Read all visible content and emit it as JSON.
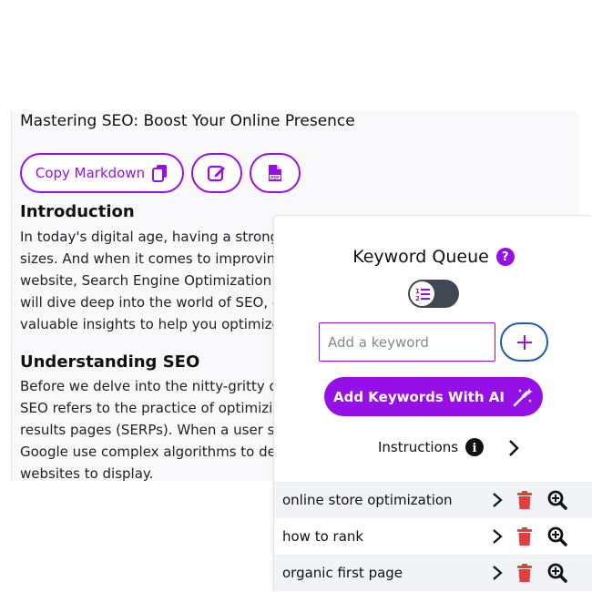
{
  "article": {
    "title": "Mastering SEO: Boost Your Online Presence",
    "copy_button_label": "Copy Markdown",
    "sections": [
      {
        "heading": "Introduction",
        "lines": [
          "In today's digital age, having a strong o",
          "sizes. And when it comes to improving",
          "website, Search Engine Optimization (S",
          "will dive deep into the world of SEO, ex",
          "valuable insights to help you optimize y"
        ]
      },
      {
        "heading": "Understanding SEO",
        "lines": [
          "Before we delve into the nitty-gritty of",
          "SEO refers to the practice of optimizing",
          "results pages (SERPs). When a user se",
          "Google use complex algorithms to dete",
          "websites to display."
        ]
      }
    ]
  },
  "queue": {
    "title": "Keyword Queue",
    "help_glyph": "?",
    "input_placeholder": "Add a keyword",
    "input_value": "",
    "ai_button_label": "Add Keywords With AI",
    "instructions_label": "Instructions",
    "info_glyph": "i",
    "keywords": [
      {
        "label": "online store optimization"
      },
      {
        "label": "how to rank"
      },
      {
        "label": "organic first page"
      }
    ]
  },
  "colors": {
    "accent": "#9510e6",
    "blue": "#2259b4",
    "danger": "#e53e3e",
    "toggle": "#414854"
  },
  "icons": [
    "copy-icon",
    "edit-icon",
    "pdf-icon",
    "help-icon",
    "list-order-icon",
    "plus-icon",
    "magic-wand-icon",
    "info-icon",
    "chevron-right-icon",
    "trash-icon",
    "zoom-in-icon"
  ]
}
